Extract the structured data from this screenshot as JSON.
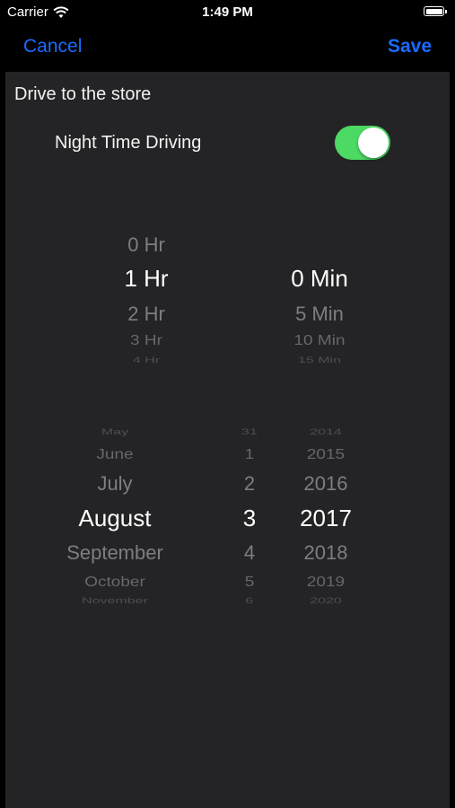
{
  "status_bar": {
    "carrier": "Carrier",
    "time": "1:49 PM"
  },
  "nav": {
    "cancel_label": "Cancel",
    "save_label": "Save"
  },
  "trip": {
    "title": "Drive to the store"
  },
  "night_toggle": {
    "label": "Night Time Driving",
    "on": true,
    "color": "#4cd964"
  },
  "duration_picker": {
    "hours": [
      "0 Hr",
      "1 Hr",
      "2 Hr",
      "3 Hr",
      "4 Hr"
    ],
    "selected_hours": "1 Hr",
    "minutes": [
      "0 Min",
      "5 Min",
      "10 Min",
      "15 Min"
    ],
    "selected_minutes": "0 Min"
  },
  "date_picker": {
    "months": [
      "May",
      "June",
      "July",
      "August",
      "September",
      "October",
      "November"
    ],
    "selected_month": "August",
    "days": [
      "31",
      "1",
      "2",
      "3",
      "4",
      "5",
      "6"
    ],
    "selected_day": "3",
    "years": [
      "2014",
      "2015",
      "2016",
      "2017",
      "2018",
      "2019",
      "2020"
    ],
    "selected_year": "2017"
  },
  "colors": {
    "accent": "#1a6bff",
    "panel_background": "#242426",
    "background": "#000000"
  }
}
